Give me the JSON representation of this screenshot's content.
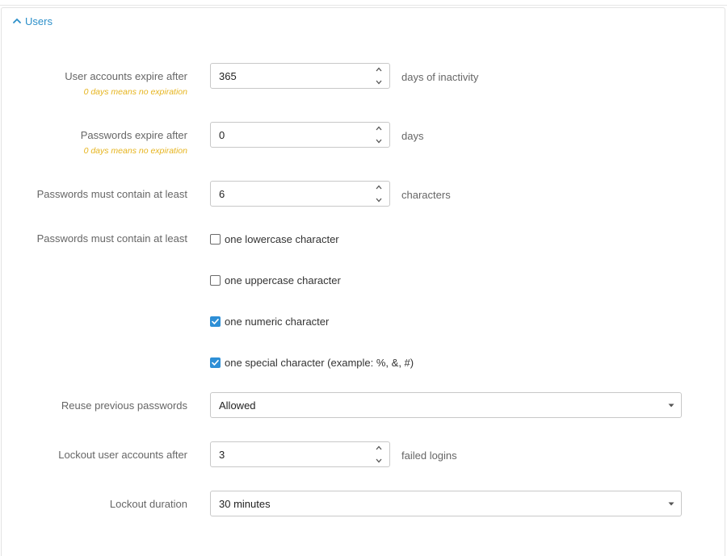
{
  "section": {
    "title": "Users",
    "icon": "chevron-up-icon",
    "accent_color": "#2c8fc9"
  },
  "fields": {
    "account_expiry": {
      "label": "User accounts expire after",
      "hint": "0 days means no expiration",
      "value": "365",
      "suffix": "days of inactivity"
    },
    "password_expiry": {
      "label": "Passwords expire after",
      "hint": "0 days means no expiration",
      "value": "0",
      "suffix": "days"
    },
    "min_length": {
      "label": "Passwords must contain at least",
      "value": "6",
      "suffix": "characters"
    },
    "complexity": {
      "label": "Passwords must contain at least",
      "options": [
        {
          "label": "one lowercase character",
          "checked": false
        },
        {
          "label": "one uppercase character",
          "checked": false
        },
        {
          "label": "one numeric character",
          "checked": true
        },
        {
          "label": "one special character (example: %, &, #)",
          "checked": true
        }
      ]
    },
    "reuse": {
      "label": "Reuse previous passwords",
      "selected": "Allowed"
    },
    "lockout_after": {
      "label": "Lockout user accounts after",
      "value": "3",
      "suffix": "failed logins"
    },
    "lockout_duration": {
      "label": "Lockout duration",
      "selected": "30 minutes"
    }
  },
  "colors": {
    "hint": "#e6b41e",
    "checkbox_checked": "#2e8fd6",
    "label": "#666666"
  }
}
